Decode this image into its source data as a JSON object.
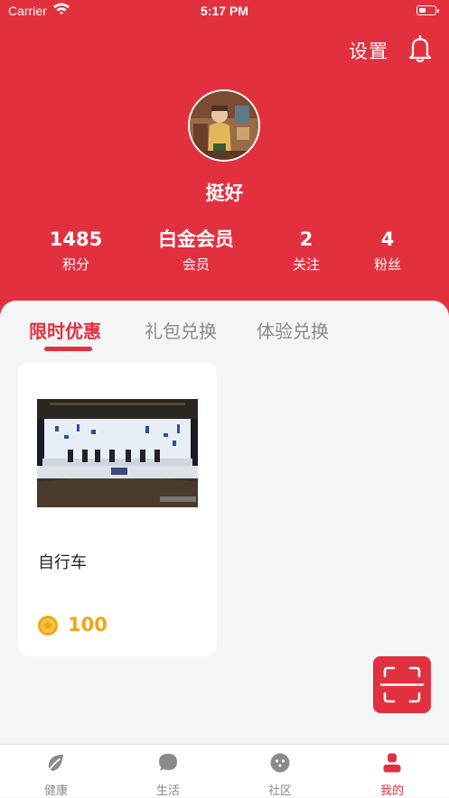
{
  "status_bar": {
    "carrier": "Carrier",
    "time": "5:17 PM"
  },
  "header": {
    "settings_label": "设置",
    "username": "挺好",
    "stats": [
      {
        "value": "1485",
        "label": "积分"
      },
      {
        "value": "白金会员",
        "label": "会员"
      },
      {
        "value": "2",
        "label": "关注"
      },
      {
        "value": "4",
        "label": "粉丝"
      }
    ]
  },
  "tabs": [
    {
      "label": "限时优惠",
      "active": true
    },
    {
      "label": "礼包兑换",
      "active": false
    },
    {
      "label": "体验兑换",
      "active": false
    }
  ],
  "products": [
    {
      "title": "自行车",
      "price": "100"
    }
  ],
  "bottom_nav": [
    {
      "label": "健康",
      "icon": "leaf-icon"
    },
    {
      "label": "生活",
      "icon": "chat-bubble-icon"
    },
    {
      "label": "社区",
      "icon": "smiley-icon"
    },
    {
      "label": "我的",
      "icon": "user-icon",
      "active": true
    }
  ],
  "colors": {
    "brand": "#e3303f",
    "coin": "#f2a514",
    "inactive": "#8a8a8a"
  }
}
